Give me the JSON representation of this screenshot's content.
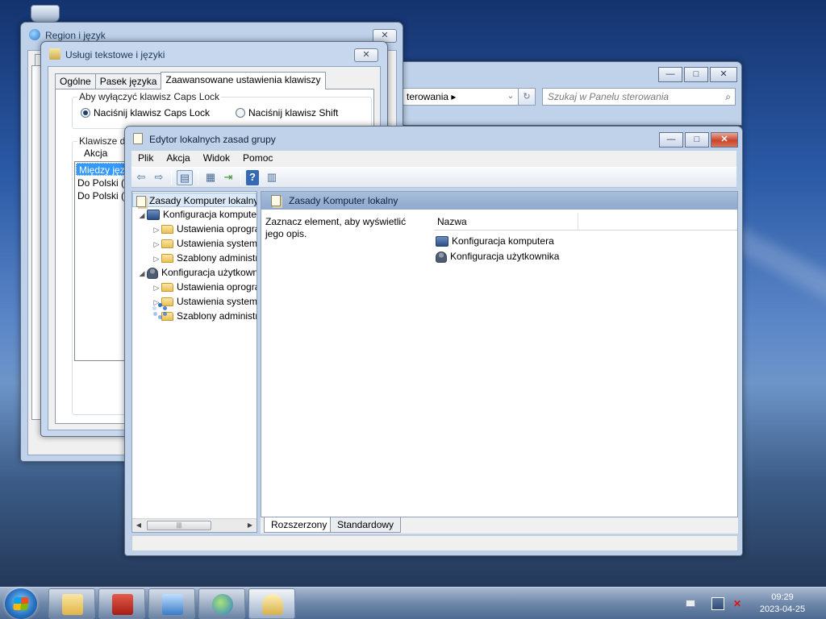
{
  "desktop": {
    "recycle_bin_icon": "recycle-bin-icon"
  },
  "region_window": {
    "title": "Region i język",
    "close": "✕"
  },
  "uslugi_window": {
    "title": "Usługi tekstowe i języki",
    "close": "✕",
    "tabs": [
      "Ogólne",
      "Pasek języka",
      "Zaawansowane ustawienia klawiszy"
    ],
    "capslock_group": "Aby wyłączyć klawisz Caps Lock",
    "radio1": "Naciśnij klawisz Caps Lock",
    "radio2": "Naciśnij klawisz Shift",
    "hotkeys_group": "Klawisze dostę",
    "list_header": "Akcja",
    "list_items": [
      "Między język",
      "Do Polski (P",
      "Do Polski (P"
    ]
  },
  "panel_window": {
    "address": "terowania",
    "search_placeholder": "Szukaj w Panelu sterowania"
  },
  "gpo_window": {
    "title": "Edytor lokalnych zasad grupy",
    "menu": [
      "Plik",
      "Akcja",
      "Widok",
      "Pomoc"
    ],
    "tree": {
      "root": "Zasady Komputer lokalny",
      "computer": "Konfiguracja komputera",
      "computer_children": [
        "Ustawienia oprogramowania",
        "Ustawienia systemu Windows",
        "Szablony administracyjne"
      ],
      "user": "Konfiguracja użytkownika",
      "user_children": [
        "Ustawienia oprogramowania",
        "Ustawienia systemu Windows",
        "Szablony administracyjne"
      ]
    },
    "right_header": "Zasady Komputer lokalny",
    "description": "Zaznacz element, aby wyświetlić jego opis.",
    "column_name": "Nazwa",
    "items": [
      "Konfiguracja komputera",
      "Konfiguracja użytkownika"
    ],
    "bottom_tabs": [
      "Rozszerzony",
      "Standardowy"
    ]
  },
  "taskbar": {
    "time": "09:29",
    "date": "2023-04-25",
    "apps": [
      "explorer",
      "toolbox",
      "control-panel",
      "region-clock",
      "text-services"
    ]
  }
}
